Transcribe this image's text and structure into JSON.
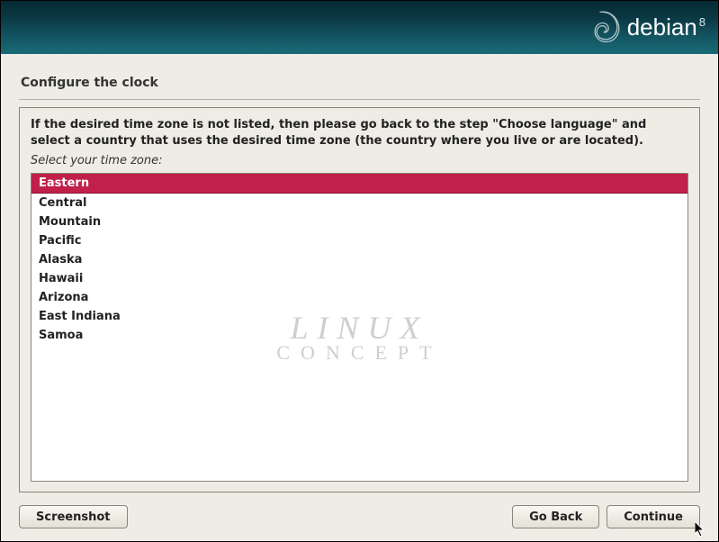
{
  "brand": {
    "name": "debian",
    "version": "8"
  },
  "title": "Configure the clock",
  "instruction": "If the desired time zone is not listed, then please go back to the step \"Choose language\" and select a country that uses the desired time zone (the country where you live or are located).",
  "prompt": "Select your time zone:",
  "timezones": [
    {
      "label": "Eastern",
      "selected": true
    },
    {
      "label": "Central",
      "selected": false
    },
    {
      "label": "Mountain",
      "selected": false
    },
    {
      "label": "Pacific",
      "selected": false
    },
    {
      "label": "Alaska",
      "selected": false
    },
    {
      "label": "Hawaii",
      "selected": false
    },
    {
      "label": "Arizona",
      "selected": false
    },
    {
      "label": "East Indiana",
      "selected": false
    },
    {
      "label": "Samoa",
      "selected": false
    }
  ],
  "watermark": {
    "line1": "LINUX",
    "line2": "CONCEPT"
  },
  "buttons": {
    "screenshot": "Screenshot",
    "go_back": "Go Back",
    "continue": "Continue"
  }
}
